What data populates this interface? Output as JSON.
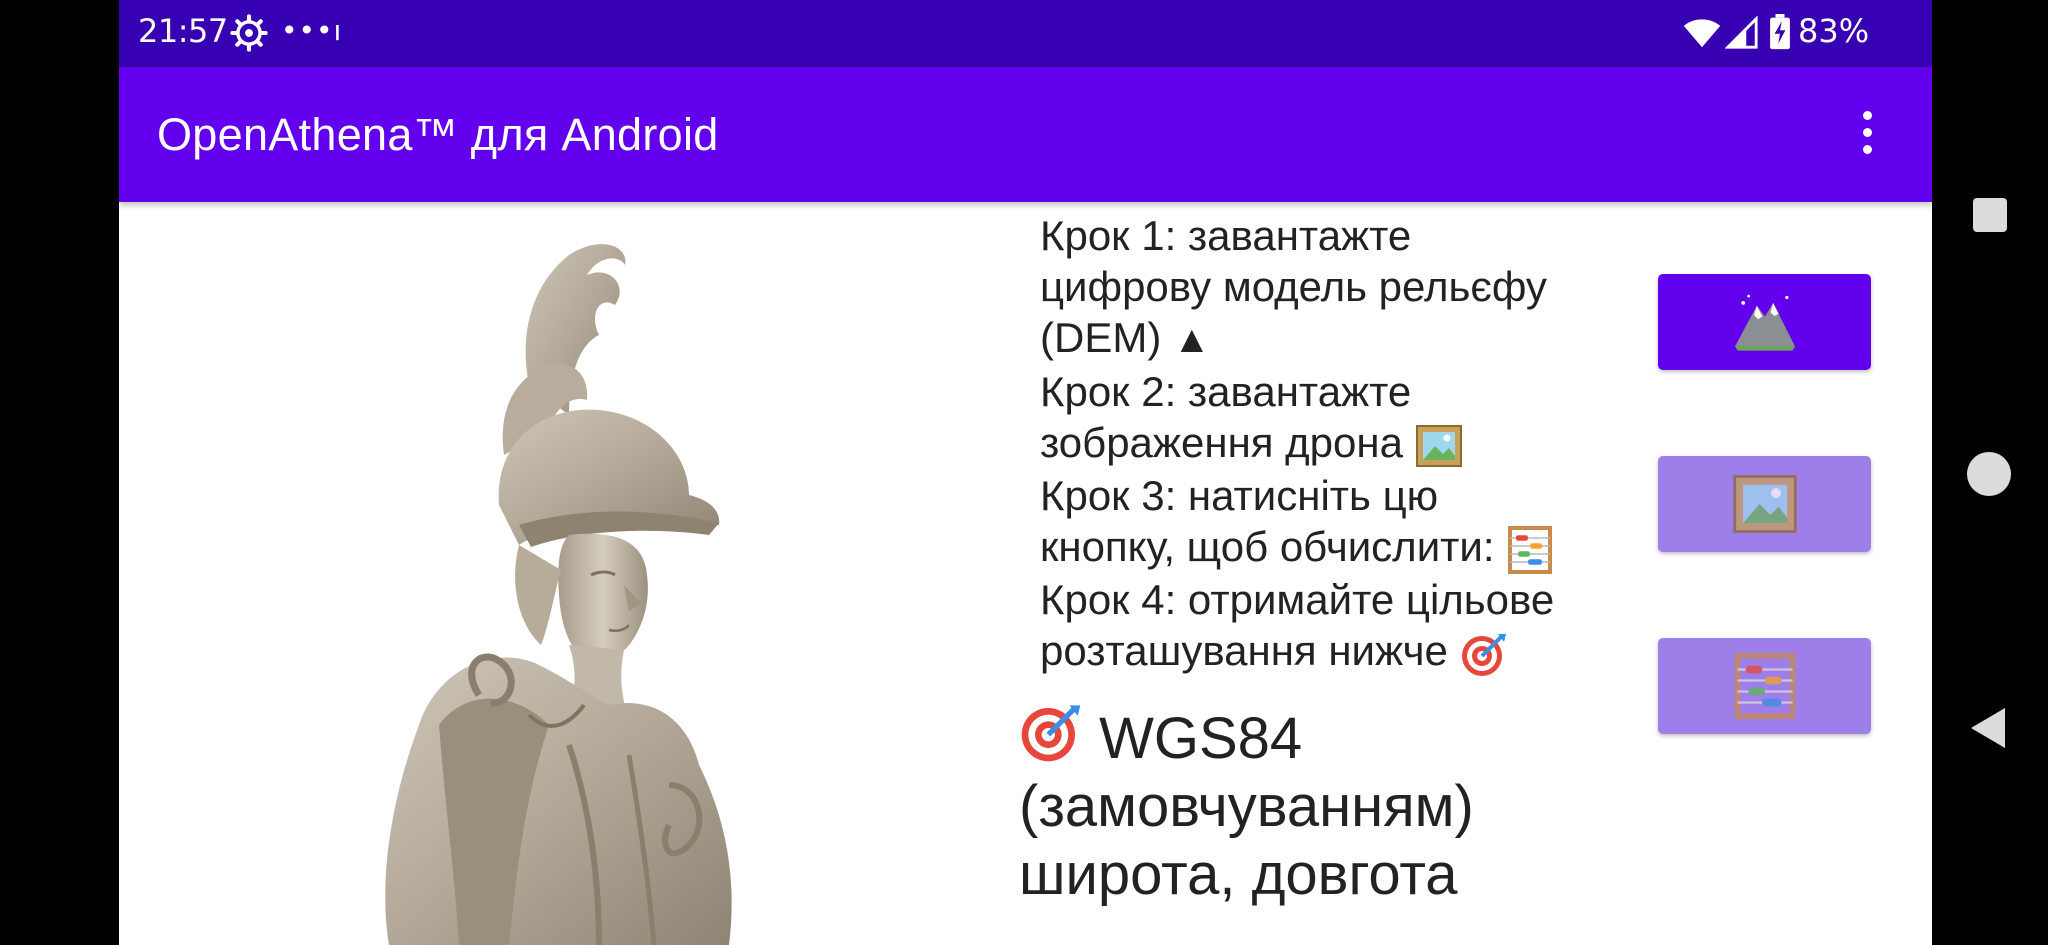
{
  "status_bar": {
    "time": "21:57",
    "settings_icon": "gear-icon",
    "notifications_text": "•••ı",
    "wifi_icon": "wifi-icon",
    "signal_icon": "cell-signal-icon",
    "battery_icon": "battery-charging-icon",
    "battery_percent": "83%"
  },
  "app_bar": {
    "title": "OpenAthena™ для Android",
    "menu_icon": "overflow-menu-icon"
  },
  "steps": [
    {
      "text": "Крок 1: завантажте цифрову модель рельєфу (DEM) ",
      "emoji": "▲"
    },
    {
      "text": "Крок 2: завантажте зображення дрона ",
      "emoji": "picture-icon"
    },
    {
      "text": "Крок 3: натисніть цю кнопку, щоб обчислити: ",
      "emoji": "abacus-icon"
    },
    {
      "text": "Крок 4: отримайте цільове розташування нижче ",
      "emoji": "target-icon"
    }
  ],
  "result": {
    "icon": "target-icon",
    "line1": "WGS84",
    "line2": "(замовчуванням)",
    "line3": "широта, довгота"
  },
  "buttons": {
    "load_dem": {
      "icon": "mountain-icon",
      "enabled": true
    },
    "load_image": {
      "icon": "picture-icon",
      "enabled": false
    },
    "calculate": {
      "icon": "abacus-icon",
      "enabled": false
    }
  },
  "nav_bar": {
    "recents_icon": "recents-square-icon",
    "home_icon": "home-circle-icon",
    "back_icon": "back-triangle-icon"
  },
  "colors": {
    "status_bar": "#3700b3",
    "app_bar": "#6200ee",
    "button_enabled": "#6200ee",
    "button_disabled": "#9e7ee8"
  },
  "image": {
    "statue_icon": "athena-statue-image"
  }
}
